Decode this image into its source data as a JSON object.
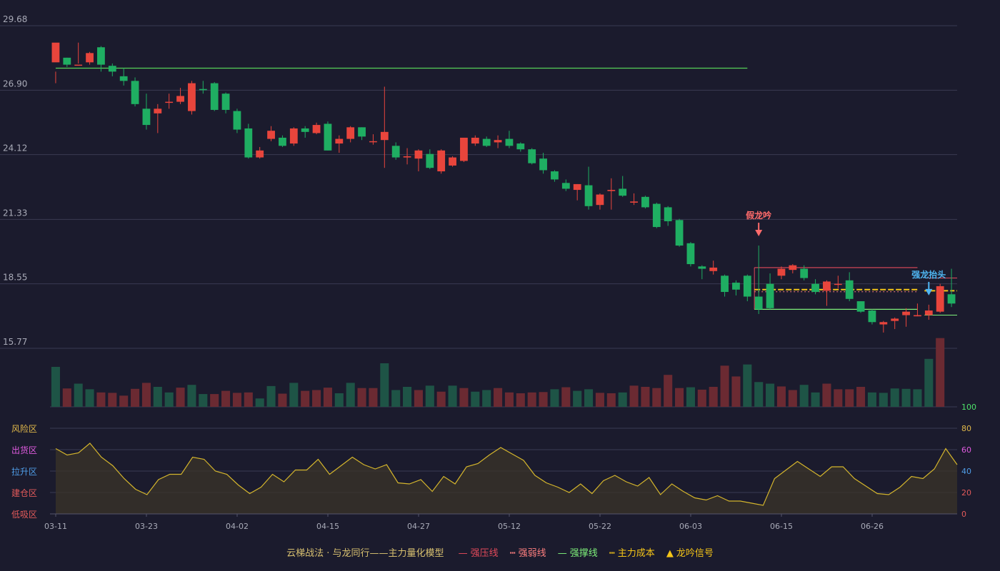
{
  "colors": {
    "up": "#e8453c",
    "down": "#1fae62",
    "vol_up": "#6b2a32",
    "vol_down": "#1e5446",
    "grid": "#3a3b52",
    "axis_text": "#a9abb8",
    "indicator_line": "#d4b52c",
    "ma_line": "#56d158",
    "resist": "#e24a5a",
    "support": "#7ef07a",
    "cost": "#f5c518",
    "weak": "#ff7f7f",
    "signal_fake": "#ff6b6b",
    "signal_strong": "#4fb6f2"
  },
  "chart_data": {
    "type": "candlestick",
    "price_axis": {
      "ticks": [
        "29.68",
        "26.90",
        "24.12",
        "21.33",
        "18.55",
        "15.77"
      ],
      "ylim": [
        15.77,
        29.68
      ]
    },
    "x_labels": [
      "03-11",
      "03-23",
      "04-02",
      "04-15",
      "04-27",
      "05-12",
      "05-22",
      "06-03",
      "06-15",
      "06-26"
    ],
    "candles": [
      [
        28.1,
        28.95,
        27.7,
        27.2
      ],
      [
        28.3,
        28.0,
        27.9,
        28.3
      ],
      [
        28.0,
        28.0,
        28.05,
        28.95
      ],
      [
        28.1,
        28.5,
        28.0,
        28.55
      ],
      [
        28.75,
        28.0,
        27.7,
        28.8
      ],
      [
        27.95,
        27.7,
        27.5,
        28.05
      ],
      [
        27.5,
        27.3,
        27.1,
        27.85
      ],
      [
        27.3,
        26.3,
        26.2,
        27.45
      ],
      [
        26.1,
        25.4,
        25.2,
        26.75
      ],
      [
        25.9,
        26.1,
        25.05,
        26.3
      ],
      [
        26.4,
        26.4,
        26.1,
        26.75
      ],
      [
        26.4,
        26.65,
        26.3,
        27.0
      ],
      [
        26.0,
        27.2,
        25.85,
        27.3
      ],
      [
        26.95,
        26.9,
        26.75,
        27.3
      ],
      [
        27.2,
        26.05,
        26.0,
        27.25
      ],
      [
        26.75,
        26.05,
        25.9,
        26.8
      ],
      [
        26.0,
        25.2,
        25.05,
        26.1
      ],
      [
        25.25,
        24.0,
        23.95,
        25.45
      ],
      [
        24.0,
        24.3,
        23.95,
        24.45
      ],
      [
        24.8,
        25.15,
        24.7,
        25.35
      ],
      [
        24.85,
        24.5,
        24.45,
        24.95
      ],
      [
        24.6,
        25.25,
        24.5,
        25.3
      ],
      [
        25.25,
        25.1,
        24.85,
        25.35
      ],
      [
        25.05,
        25.4,
        25.0,
        25.5
      ],
      [
        25.45,
        24.3,
        24.3,
        25.55
      ],
      [
        24.6,
        24.8,
        24.2,
        24.95
      ],
      [
        24.8,
        25.3,
        24.65,
        25.35
      ],
      [
        25.3,
        24.9,
        24.75,
        25.3
      ],
      [
        24.7,
        24.7,
        24.55,
        25.0
      ],
      [
        24.75,
        25.1,
        23.55,
        27.05
      ],
      [
        24.5,
        24.0,
        23.9,
        24.65
      ],
      [
        24.0,
        24.05,
        23.7,
        24.4
      ],
      [
        23.95,
        24.3,
        23.4,
        24.35
      ],
      [
        24.15,
        23.55,
        23.5,
        24.35
      ],
      [
        23.4,
        24.3,
        23.3,
        24.35
      ],
      [
        23.65,
        24.0,
        23.6,
        24.05
      ],
      [
        23.85,
        24.85,
        23.8,
        24.85
      ],
      [
        24.6,
        24.85,
        24.5,
        24.95
      ],
      [
        24.8,
        24.5,
        24.45,
        24.9
      ],
      [
        24.65,
        24.75,
        24.4,
        24.95
      ],
      [
        24.8,
        24.5,
        24.4,
        25.15
      ],
      [
        24.6,
        24.35,
        24.25,
        24.65
      ],
      [
        24.35,
        23.75,
        23.7,
        24.4
      ],
      [
        23.95,
        23.45,
        23.3,
        24.2
      ],
      [
        23.4,
        23.05,
        22.95,
        23.45
      ],
      [
        22.9,
        22.65,
        22.55,
        23.05
      ],
      [
        22.6,
        22.85,
        22.15,
        22.85
      ],
      [
        22.8,
        21.9,
        21.75,
        23.6
      ],
      [
        21.95,
        22.4,
        21.75,
        22.45
      ],
      [
        22.55,
        22.6,
        21.75,
        23.1
      ],
      [
        22.65,
        22.35,
        22.3,
        23.2
      ],
      [
        22.05,
        22.1,
        21.95,
        22.45
      ],
      [
        22.3,
        21.85,
        21.8,
        22.35
      ],
      [
        22.0,
        21.0,
        20.95,
        22.05
      ],
      [
        21.85,
        21.25,
        21.05,
        21.9
      ],
      [
        21.3,
        20.2,
        20.15,
        21.35
      ],
      [
        20.3,
        19.4,
        19.3,
        20.35
      ],
      [
        19.3,
        19.2,
        18.75,
        19.35
      ],
      [
        19.1,
        19.25,
        18.95,
        19.55
      ],
      [
        18.9,
        18.2,
        18.0,
        18.95
      ],
      [
        18.6,
        18.3,
        18.05,
        18.7
      ],
      [
        18.9,
        18.0,
        17.8,
        18.95
      ],
      [
        18.0,
        17.45,
        17.25,
        20.2
      ],
      [
        18.55,
        17.5,
        17.45,
        19.0
      ],
      [
        18.9,
        19.2,
        18.75,
        19.3
      ],
      [
        19.15,
        19.35,
        19.0,
        19.4
      ],
      [
        19.2,
        18.8,
        18.7,
        19.35
      ],
      [
        18.55,
        18.2,
        18.1,
        18.75
      ],
      [
        18.25,
        18.65,
        17.6,
        18.7
      ],
      [
        18.55,
        18.55,
        18.35,
        18.9
      ],
      [
        18.7,
        17.9,
        17.8,
        19.05
      ],
      [
        17.8,
        17.35,
        17.3,
        17.8
      ],
      [
        17.4,
        16.9,
        16.8,
        17.45
      ],
      [
        16.8,
        16.9,
        16.45,
        16.95
      ],
      [
        16.95,
        17.05,
        16.6,
        17.1
      ],
      [
        17.2,
        17.35,
        16.7,
        17.5
      ],
      [
        17.15,
        17.2,
        17.15,
        17.7
      ],
      [
        17.2,
        17.4,
        17.0,
        17.65
      ],
      [
        17.35,
        18.45,
        17.3,
        18.55
      ],
      [
        18.1,
        17.7,
        17.55,
        19.2
      ]
    ],
    "volume": [
      [
        1.0,
        0
      ],
      [
        0.46,
        1
      ],
      [
        0.58,
        0
      ],
      [
        0.44,
        0
      ],
      [
        0.36,
        1
      ],
      [
        0.35,
        1
      ],
      [
        0.28,
        1
      ],
      [
        0.45,
        1
      ],
      [
        0.6,
        1
      ],
      [
        0.5,
        0
      ],
      [
        0.36,
        0
      ],
      [
        0.48,
        1
      ],
      [
        0.55,
        0
      ],
      [
        0.32,
        0
      ],
      [
        0.32,
        1
      ],
      [
        0.4,
        1
      ],
      [
        0.35,
        1
      ],
      [
        0.36,
        1
      ],
      [
        0.21,
        0
      ],
      [
        0.52,
        0
      ],
      [
        0.33,
        1
      ],
      [
        0.6,
        0
      ],
      [
        0.4,
        1
      ],
      [
        0.42,
        1
      ],
      [
        0.48,
        1
      ],
      [
        0.34,
        0
      ],
      [
        0.6,
        0
      ],
      [
        0.47,
        1
      ],
      [
        0.47,
        1
      ],
      [
        1.09,
        0
      ],
      [
        0.42,
        0
      ],
      [
        0.5,
        0
      ],
      [
        0.42,
        1
      ],
      [
        0.53,
        0
      ],
      [
        0.38,
        1
      ],
      [
        0.53,
        0
      ],
      [
        0.47,
        1
      ],
      [
        0.38,
        0
      ],
      [
        0.42,
        0
      ],
      [
        0.47,
        1
      ],
      [
        0.36,
        1
      ],
      [
        0.34,
        1
      ],
      [
        0.36,
        1
      ],
      [
        0.37,
        1
      ],
      [
        0.44,
        0
      ],
      [
        0.49,
        1
      ],
      [
        0.4,
        0
      ],
      [
        0.44,
        0
      ],
      [
        0.35,
        1
      ],
      [
        0.34,
        1
      ],
      [
        0.36,
        0
      ],
      [
        0.53,
        1
      ],
      [
        0.5,
        1
      ],
      [
        0.47,
        1
      ],
      [
        0.8,
        1
      ],
      [
        0.47,
        1
      ],
      [
        0.49,
        0
      ],
      [
        0.43,
        1
      ],
      [
        0.5,
        1
      ],
      [
        1.03,
        1
      ],
      [
        0.76,
        1
      ],
      [
        1.06,
        0
      ],
      [
        0.62,
        0
      ],
      [
        0.58,
        0
      ],
      [
        0.51,
        1
      ],
      [
        0.42,
        1
      ],
      [
        0.55,
        0
      ],
      [
        0.36,
        0
      ],
      [
        0.58,
        1
      ],
      [
        0.44,
        1
      ],
      [
        0.44,
        1
      ],
      [
        0.5,
        1
      ],
      [
        0.36,
        0
      ],
      [
        0.35,
        0
      ],
      [
        0.46,
        0
      ],
      [
        0.45,
        0
      ],
      [
        0.44,
        0
      ],
      [
        1.2,
        0
      ],
      [
        1.72,
        1
      ]
    ],
    "ma_line": {
      "value": 27.85
    },
    "box": {
      "resist": 19.25,
      "support": 17.45,
      "cost": 18.3,
      "cost_right": 18.25,
      "resist_right": 18.8,
      "support_right": 17.2
    },
    "signals": [
      {
        "label": "假龙吟",
        "index": 62,
        "kind": "fake"
      },
      {
        "label": "强龙抬头",
        "index": 77,
        "kind": "strong"
      }
    ],
    "indicator": {
      "ylim": [
        0,
        100
      ],
      "ticks": [
        "100",
        "80",
        "60",
        "40",
        "20",
        "0"
      ],
      "zones": [
        "风险区",
        "出货区",
        "拉升区",
        "建仓区",
        "低吸区"
      ],
      "zone_colors": [
        "#e0b84a",
        "#e05be0",
        "#4f9de8",
        "#e25a5a",
        "#e25a5a"
      ],
      "values": [
        61,
        55,
        57,
        66,
        53,
        45,
        33,
        23,
        18,
        32,
        37,
        37,
        53,
        51,
        40,
        37,
        27,
        19,
        25,
        37,
        30,
        41,
        41,
        51,
        37,
        45,
        53,
        46,
        42,
        46,
        29,
        28,
        32,
        21,
        35,
        28,
        44,
        47,
        55,
        62,
        56,
        50,
        36,
        29,
        25,
        20,
        28,
        19,
        31,
        36,
        30,
        26,
        34,
        18,
        28,
        21,
        15,
        13,
        17,
        12,
        12,
        10,
        8,
        33,
        41,
        49,
        42,
        35,
        44,
        44,
        33,
        26,
        19,
        18,
        25,
        35,
        33,
        42,
        61,
        46
      ]
    },
    "legend": [
      "云梯战法 · 与龙同行——主力量化模型",
      "强压线",
      "强弱线",
      "强撑线",
      "主力成本",
      "龙吟信号"
    ]
  }
}
